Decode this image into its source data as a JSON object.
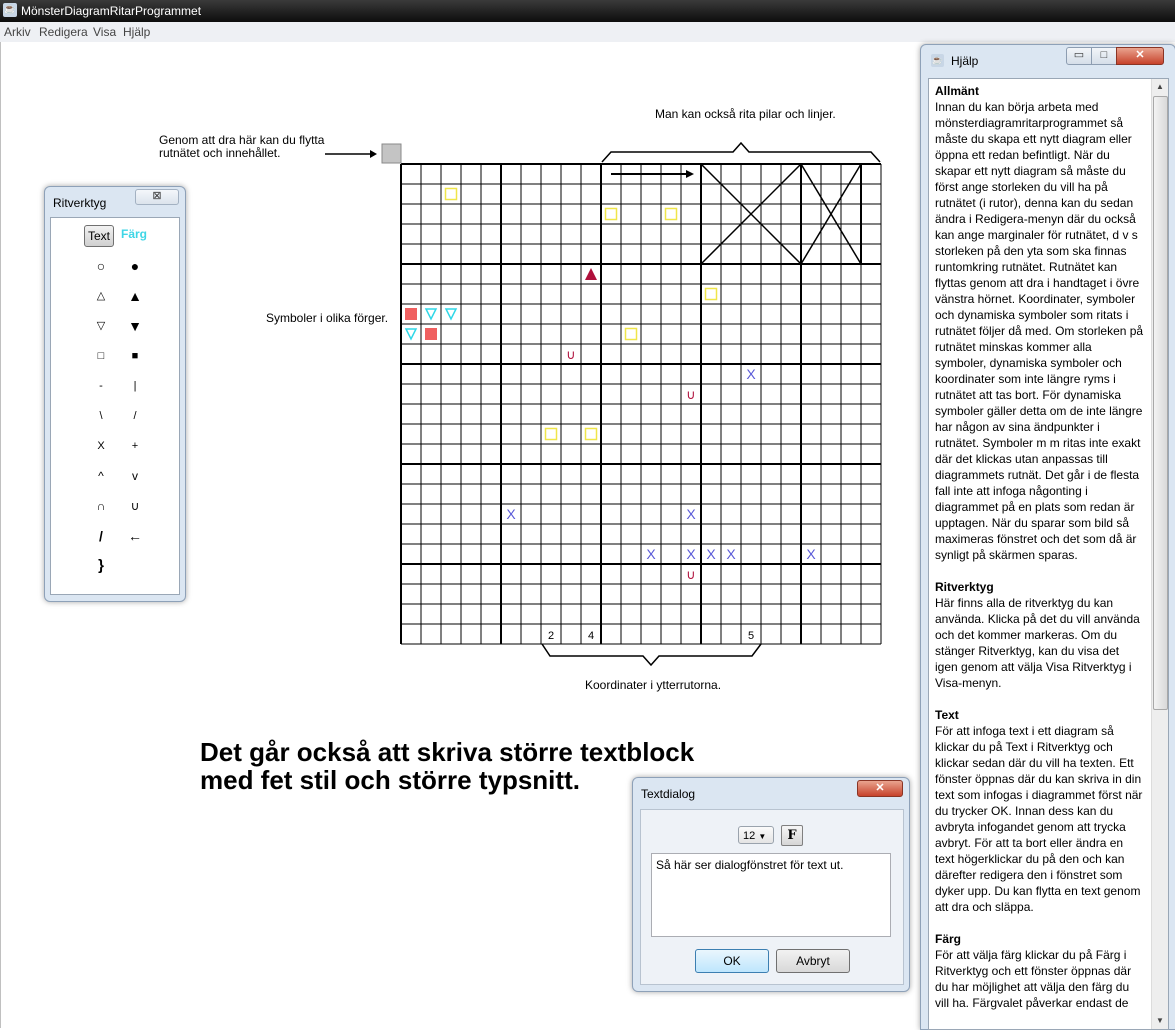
{
  "app": {
    "title": "MönsterDiagramRitarProgrammet",
    "icon": "java-icon"
  },
  "menu": [
    "Arkiv",
    "Redigera",
    "Visa",
    "Hjälp"
  ],
  "annotations": {
    "drag_handle": "Genom att dra här kan du flytta\nrutnätet och innehållet.",
    "arrows_lines": "Man kan också rita pilar och linjer.",
    "colored_symbols": "Symboler i olika förger.",
    "coordinates": "Koordinater i ytterrutorna.",
    "big_text": "Det går också att skriva större textblock\nmed fet stil och större typsnitt."
  },
  "grid": {
    "coordinate_labels": [
      "2",
      "4",
      "5"
    ]
  },
  "toolbox": {
    "title": "Ritverktyg",
    "close": "⊠",
    "text_label": "Text",
    "color_label": "Färg",
    "tools": [
      "○",
      "●",
      "△",
      "▲",
      "▽",
      "▼",
      "□",
      "■",
      "-",
      "|",
      "\\",
      "/",
      "X",
      "+",
      "^",
      "v",
      "∩",
      "∪",
      "/",
      "←",
      "}"
    ]
  },
  "help": {
    "title": "Hjälp",
    "buttons": {
      "minimize": "▭",
      "maximize": "□",
      "close": "✕"
    },
    "sections": [
      {
        "heading": "Allmänt",
        "body": "Innan du kan börja arbeta med mönsterdiagramritarprogrammet så måste du skapa ett nytt diagram eller öppna ett redan befintligt. När du skapar ett nytt diagram så måste du först ange storleken du vill ha på rutnätet (i rutor), denna kan du sedan ändra i Redigera-menyn där du också kan ange marginaler för rutnätet, d v s storleken på den yta som ska finnas runtomkring rutnätet. Rutnätet kan flyttas genom att dra i handtaget i övre vänstra hörnet. Koordinater, symboler och dynamiska symboler som ritats i rutnätet följer då med. Om storleken på rutnätet minskas kommer alla symboler, dynamiska symboler och koordinater som inte längre ryms i rutnätet att tas bort. För dynamiska symboler gäller detta om de inte längre har någon av sina ändpunkter i rutnätet. Symboler m m ritas inte exakt där det klickas utan anpassas till diagrammets rutnät. Det går i de flesta fall inte att infoga någonting i diagrammet på en plats som redan är upptagen. När du sparar som bild så maximeras fönstret och det som då är synligt på skärmen sparas."
      },
      {
        "heading": "Ritverktyg",
        "body": "Här finns alla de ritverktyg du kan använda. Klicka på det du vill använda och det kommer markeras. Om du stänger Ritverktyg, kan du visa det igen genom att välja Visa Ritverktyg i Visa-menyn."
      },
      {
        "heading": "Text",
        "body": "För att infoga text i ett diagram så klickar du på Text i Ritverktyg och klickar sedan där du vill ha texten. Ett fönster öppnas där du kan skriva in din text som infogas i diagrammet först när du trycker OK. Innan dess kan du avbryta infogandet genom att trycka avbryt.  För att ta bort eller ändra en text högerklickar du på den och kan därefter redigera den i fönstret som dyker upp. Du kan flytta en text genom att dra och släppa."
      },
      {
        "heading": "Färg",
        "body": "För att välja färg klickar du på Färg i Ritverktyg och ett fönster öppnas där du har möjlighet att välja den färg du vill ha. Färgvalet påverkar endast de"
      }
    ]
  },
  "textdialog": {
    "title": "Textdialog",
    "close": "✕",
    "font_size": "12",
    "bold_label": "F",
    "text": "Så här ser dialogfönstret för text ut.",
    "ok": "OK",
    "cancel": "Avbryt"
  },
  "colors": {
    "yellow": "#f0e64a",
    "red": "#f06060",
    "cyan": "#30d8e8",
    "crimson": "#b0103c",
    "blue": "#5a5ad8"
  }
}
